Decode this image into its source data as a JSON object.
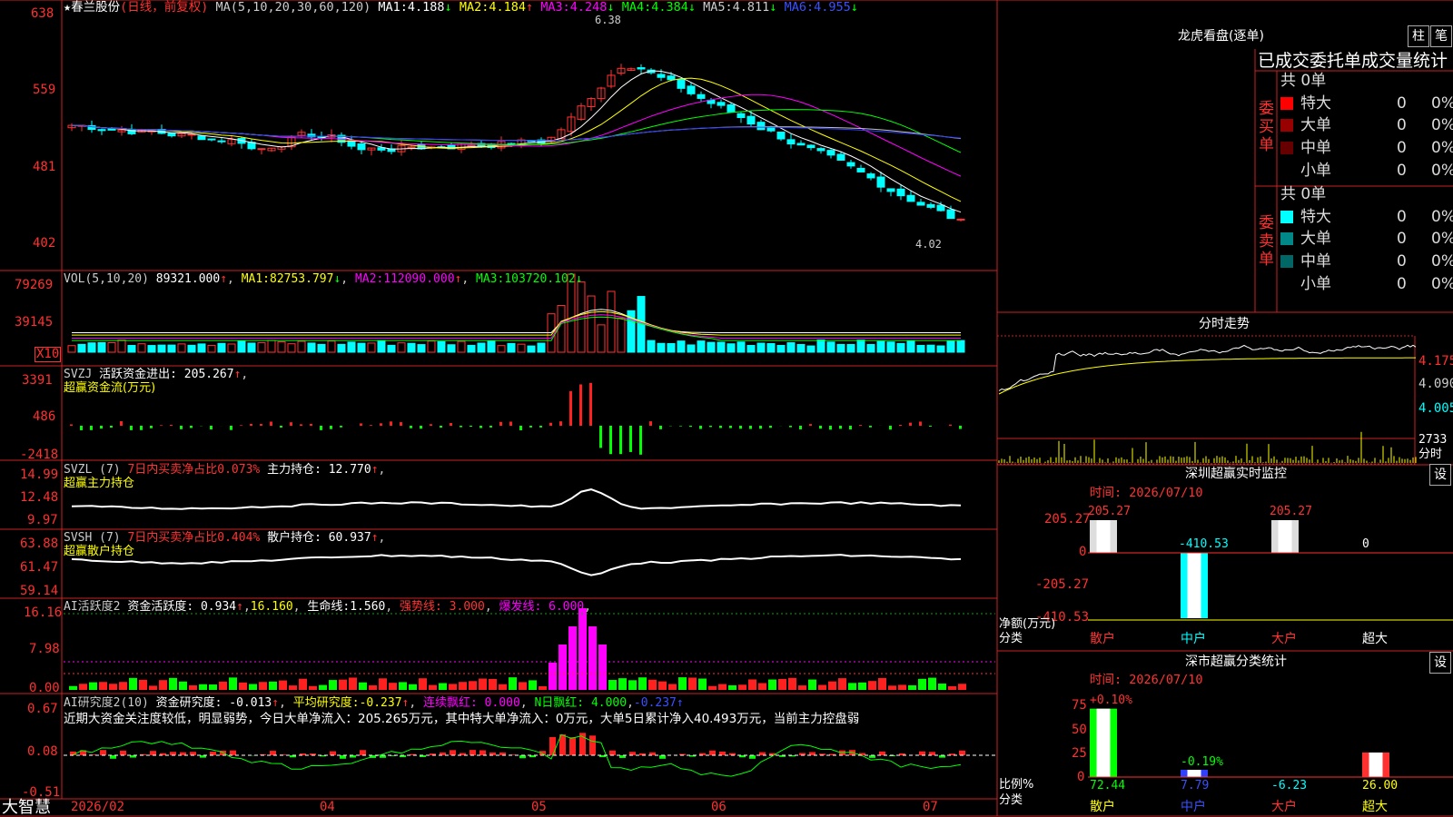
{
  "colors": {
    "up": "#ff3333",
    "down": "#00ffff",
    "bg": "#000000",
    "border": "#cc2222",
    "ma1": "#ffffff",
    "ma2": "#ffff00",
    "ma3": "#ff00ff",
    "ma4": "#00ff00",
    "ma5": "#c0c0c0",
    "ma6": "#3040ff"
  },
  "main": {
    "star": "★",
    "stock": "春兰股份",
    "mode": "(日线，前复权)",
    "ma_label": "MA(5,10,20,30,60,120)",
    "ma": [
      {
        "name": "MA1:",
        "value": "4.188",
        "arrow": "↓"
      },
      {
        "name": "MA2:",
        "value": "4.184",
        "arrow": "↑"
      },
      {
        "name": "MA3:",
        "value": "4.248",
        "arrow": "↓"
      },
      {
        "name": "MA4:",
        "value": "4.384",
        "arrow": "↓"
      },
      {
        "name": "MA5:",
        "value": "4.811",
        "arrow": "↓"
      },
      {
        "name": "MA6:",
        "value": "4.955",
        "arrow": "↓"
      }
    ],
    "hi_mark": "6.38",
    "lo_mark": "4.02",
    "axis": [
      "638",
      "559",
      "481",
      "402"
    ]
  },
  "vol": {
    "label": "VOL(5,10,20)",
    "value": "89321.000",
    "arrow": "↑",
    "ma": [
      {
        "name": "MA1:",
        "value": "82753.797",
        "arrow": "↓"
      },
      {
        "name": "MA2:",
        "value": "112090.000",
        "arrow": "↑"
      },
      {
        "name": "MA3:",
        "value": "103720.102",
        "arrow": "↓"
      }
    ],
    "axis": [
      "79269",
      "39145"
    ],
    "unit": "X10"
  },
  "svzj": {
    "name": "SVZJ",
    "field": "活跃资金进出:",
    "value": "205.267",
    "arrow": "↑",
    "comma": ",",
    "sub": "超赢资金流(万元)",
    "axis": [
      "3391",
      "486",
      "-2418"
    ]
  },
  "svzl": {
    "name": "SVZL (7)",
    "field1": "7日内买卖净占比0.073%",
    "field2": "主力持仓:",
    "value": "12.770",
    "arrow": "↑",
    "comma": ",",
    "sub": "超赢主力持仓",
    "axis": [
      "14.99",
      "12.48",
      "9.97"
    ]
  },
  "svsh": {
    "name": "SVSH (7)",
    "field1": "7日内买卖净占比0.404%",
    "field2": "散户持仓:",
    "value": "60.937",
    "arrow": "↑",
    "comma": ",",
    "sub": "超赢散户持仓",
    "axis": [
      "63.88",
      "61.47",
      "59.14"
    ]
  },
  "ai1": {
    "name": "AI活跃度2",
    "field": "资金活跃度:",
    "value": "0.934",
    "arrow": "↑",
    "v2": "16.160",
    "v3name": "生命线:",
    "v3": "1.560",
    "v4": "强势线: 3.000",
    "v5": "爆发线: 6.000",
    "axis": [
      "16.16",
      "7.98",
      "0.00"
    ]
  },
  "ai2": {
    "name": "AI研究度2(10)",
    "field": "资金研究度:",
    "value": "-0.013",
    "arrow": "↑",
    "f2": "平均研究度:",
    "v2": "-0.237",
    "a2": "↑",
    "f3": "连续飘红: 0.000",
    "f4": "N日飘红: 4.000",
    "f5": "-0.237",
    "a5": "↑",
    "comment": "近期大资金关注度较低，明显弱势，今日大单净流入：205.265万元，其中特大单净流入：0万元，大单5日累计净入40.493万元，当前主力控盘弱",
    "axis": [
      "0.67",
      "0.08",
      "-0.51"
    ]
  },
  "bottom": {
    "logo": "大智慧",
    "dates": [
      "2026/02",
      "04",
      "05",
      "06",
      "07"
    ]
  },
  "lhb": {
    "title": "龙虎看盘(逐单)",
    "btn1": "柱",
    "btn2": "笔",
    "header": "已成交委托单成交量统计",
    "buy": {
      "label": [
        "委",
        "买",
        "单"
      ],
      "total": "共 0单",
      "rows": [
        {
          "name": "特大",
          "count": "0",
          "pct": "0%",
          "color": "#ff0000"
        },
        {
          "name": "大单",
          "count": "0",
          "pct": "0%",
          "color": "#990000"
        },
        {
          "name": "中单",
          "count": "0",
          "pct": "0%",
          "color": "#660000"
        },
        {
          "name": "小单",
          "count": "0",
          "pct": "0%",
          "color": "#000000"
        }
      ]
    },
    "sell": {
      "label": [
        "委",
        "卖",
        "单"
      ],
      "total": "共 0单",
      "rows": [
        {
          "name": "特大",
          "count": "0",
          "pct": "0%",
          "color": "#00ffff"
        },
        {
          "name": "大单",
          "count": "0",
          "pct": "0%",
          "color": "#008888"
        },
        {
          "name": "中单",
          "count": "0",
          "pct": "0%",
          "color": "#006666"
        },
        {
          "name": "小单",
          "count": "0",
          "pct": "0%",
          "color": "#000000"
        }
      ]
    }
  },
  "intraday": {
    "title": "分时走势",
    "axis": [
      "4.175",
      "4.090",
      "4.005"
    ],
    "vol": "2733",
    "vol_unit": "分时"
  },
  "monitor": {
    "title": "深圳超赢实时监控",
    "btn": "设",
    "time": "时间: 2026/07/10",
    "axis": [
      "205.27",
      "0",
      "-205.27",
      "-410.53"
    ],
    "ylabel": "净额(万元)",
    "xlabel": "分类",
    "bars": [
      {
        "cat": "散户",
        "value": "205.27"
      },
      {
        "cat": "中户",
        "value": "-410.53"
      },
      {
        "cat": "大户",
        "value": "205.27"
      },
      {
        "cat": "超大",
        "value": "0"
      }
    ]
  },
  "stats": {
    "title": "深市超赢分类统计",
    "btn": "设",
    "time": "时间: 2026/07/10",
    "axis": [
      "75",
      "50",
      "25",
      "0"
    ],
    "ylabel": "比例%",
    "xlabel": "分类",
    "bars": [
      {
        "cat": "散户",
        "value": "72.44",
        "top": "+0.10%"
      },
      {
        "cat": "中户",
        "value": "7.79",
        "top": "-0.19%"
      },
      {
        "cat": "大户",
        "value": "-6.23",
        "top": ""
      },
      {
        "cat": "超大",
        "value": "26.00",
        "top": ""
      }
    ]
  }
}
